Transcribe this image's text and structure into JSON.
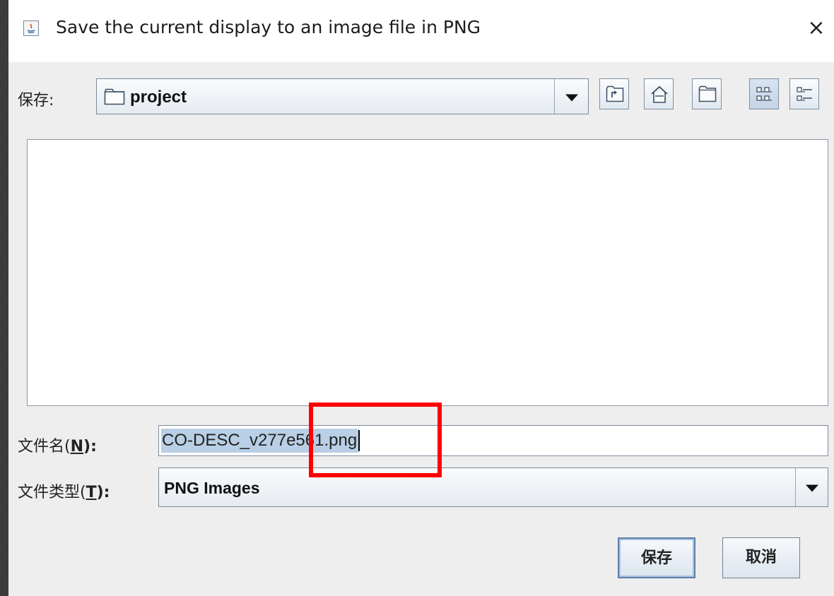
{
  "window": {
    "title": "Save the current display to an image file in PNG",
    "close_glyph": "×"
  },
  "location": {
    "label": "保存:",
    "folder": "project",
    "folder_icon": "folder-icon"
  },
  "toolbar": {
    "buttons": [
      {
        "name": "up-one-level-button",
        "icon": "folder-up-icon"
      },
      {
        "name": "home-button",
        "icon": "home-icon"
      },
      {
        "name": "new-folder-button",
        "icon": "new-folder-icon"
      },
      {
        "name": "list-view-button",
        "icon": "list-view-icon",
        "pressed": true
      },
      {
        "name": "details-view-button",
        "icon": "details-view-icon"
      }
    ]
  },
  "file_list": {
    "items": []
  },
  "filename": {
    "label_prefix": "文件名(",
    "mnemonic": "N",
    "label_suffix": "):",
    "value": "CO-DESC_v277e561.png"
  },
  "filetype": {
    "label_prefix": "文件类型(",
    "mnemonic": "T",
    "label_suffix": "):",
    "value": "PNG Images"
  },
  "actions": {
    "save_label": "保存",
    "cancel_label": "取消"
  },
  "colors": {
    "dialog_bg": "#eeeeee",
    "selection": "#b8cfe5",
    "highlight_box": "#ff0000"
  }
}
